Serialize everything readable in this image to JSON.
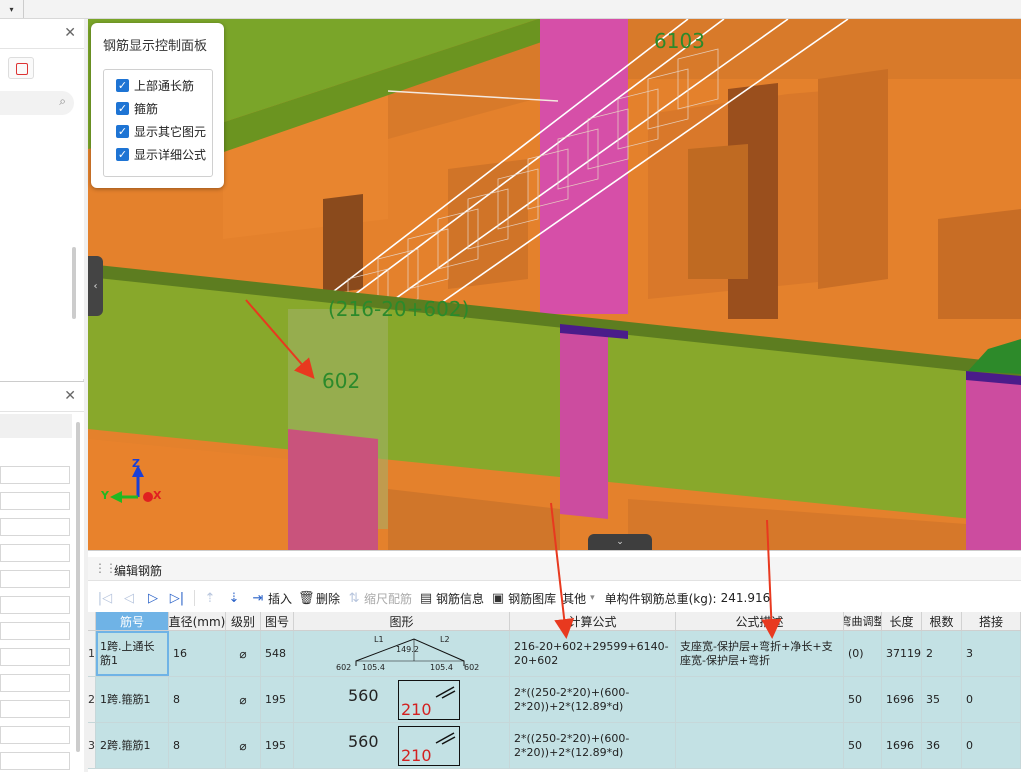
{
  "panel": {
    "title": "钢筋显示控制面板",
    "options": [
      {
        "label": "上部通长筋",
        "checked": true
      },
      {
        "label": "箍筋",
        "checked": true
      },
      {
        "label": "显示其它图元",
        "checked": true
      },
      {
        "label": "显示详细公式",
        "checked": true
      }
    ]
  },
  "viewport": {
    "labels": {
      "top_rebar": "6103",
      "mid_rebar": "(216-20+602)",
      "stirrup": "602"
    },
    "axes": {
      "z": "Z",
      "y": "Y",
      "x": "X"
    }
  },
  "editor": {
    "title": "编辑钢筋",
    "toolbar": {
      "insert": "插入",
      "delete": "删除",
      "scale_config": "缩尺配筋",
      "rebar_info": "钢筋信息",
      "rebar_library": "钢筋图库",
      "other": "其他",
      "total_weight_label": "单构件钢筋总重(kg):",
      "total_weight_value": "241.916"
    },
    "columns": [
      "筋号",
      "直径(mm)",
      "级别",
      "图号",
      "图形",
      "计算公式",
      "公式描述",
      "弯曲调整",
      "长度",
      "根数",
      "搭接"
    ],
    "rows": [
      {
        "row_no": "1",
        "name": "1跨.上通长筋1",
        "diameter": "16",
        "grade": "⌀",
        "shape_no": "548",
        "shape": {
          "L1": "L1",
          "L2": "L2",
          "a": "149.2",
          "b": "105.4",
          "c": "105.4",
          "left": "602",
          "right": "602"
        },
        "formula": "216-20+602+29599+6140-20+602",
        "description": "支座宽-保护层+弯折+净长+支座宽-保护层+弯折",
        "bend_adjust": "(0)",
        "length": "37119",
        "count": "2",
        "lap": "3"
      },
      {
        "row_no": "2",
        "name": "1跨.箍筋1",
        "diameter": "8",
        "grade": "⌀",
        "shape_no": "195",
        "shape": {
          "outer": "560",
          "inner": "210"
        },
        "formula": "2*((250-2*20)+(600-2*20))+2*(12.89*d)",
        "description": "",
        "bend_adjust": "50",
        "length": "1696",
        "count": "35",
        "lap": "0"
      },
      {
        "row_no": "3",
        "name": "2跨.箍筋1",
        "diameter": "8",
        "grade": "⌀",
        "shape_no": "195",
        "shape": {
          "outer": "560",
          "inner": "210"
        },
        "formula": "2*((250-2*20)+(600-2*20))+2*(12.89*d)",
        "description": "",
        "bend_adjust": "50",
        "length": "1696",
        "count": "36",
        "lap": "0"
      }
    ]
  },
  "colors": {
    "accent": "#1e74d4",
    "row_bg": "#c3e1e4",
    "arrow": "#e8391f",
    "label_green": "#2b8a2b"
  }
}
